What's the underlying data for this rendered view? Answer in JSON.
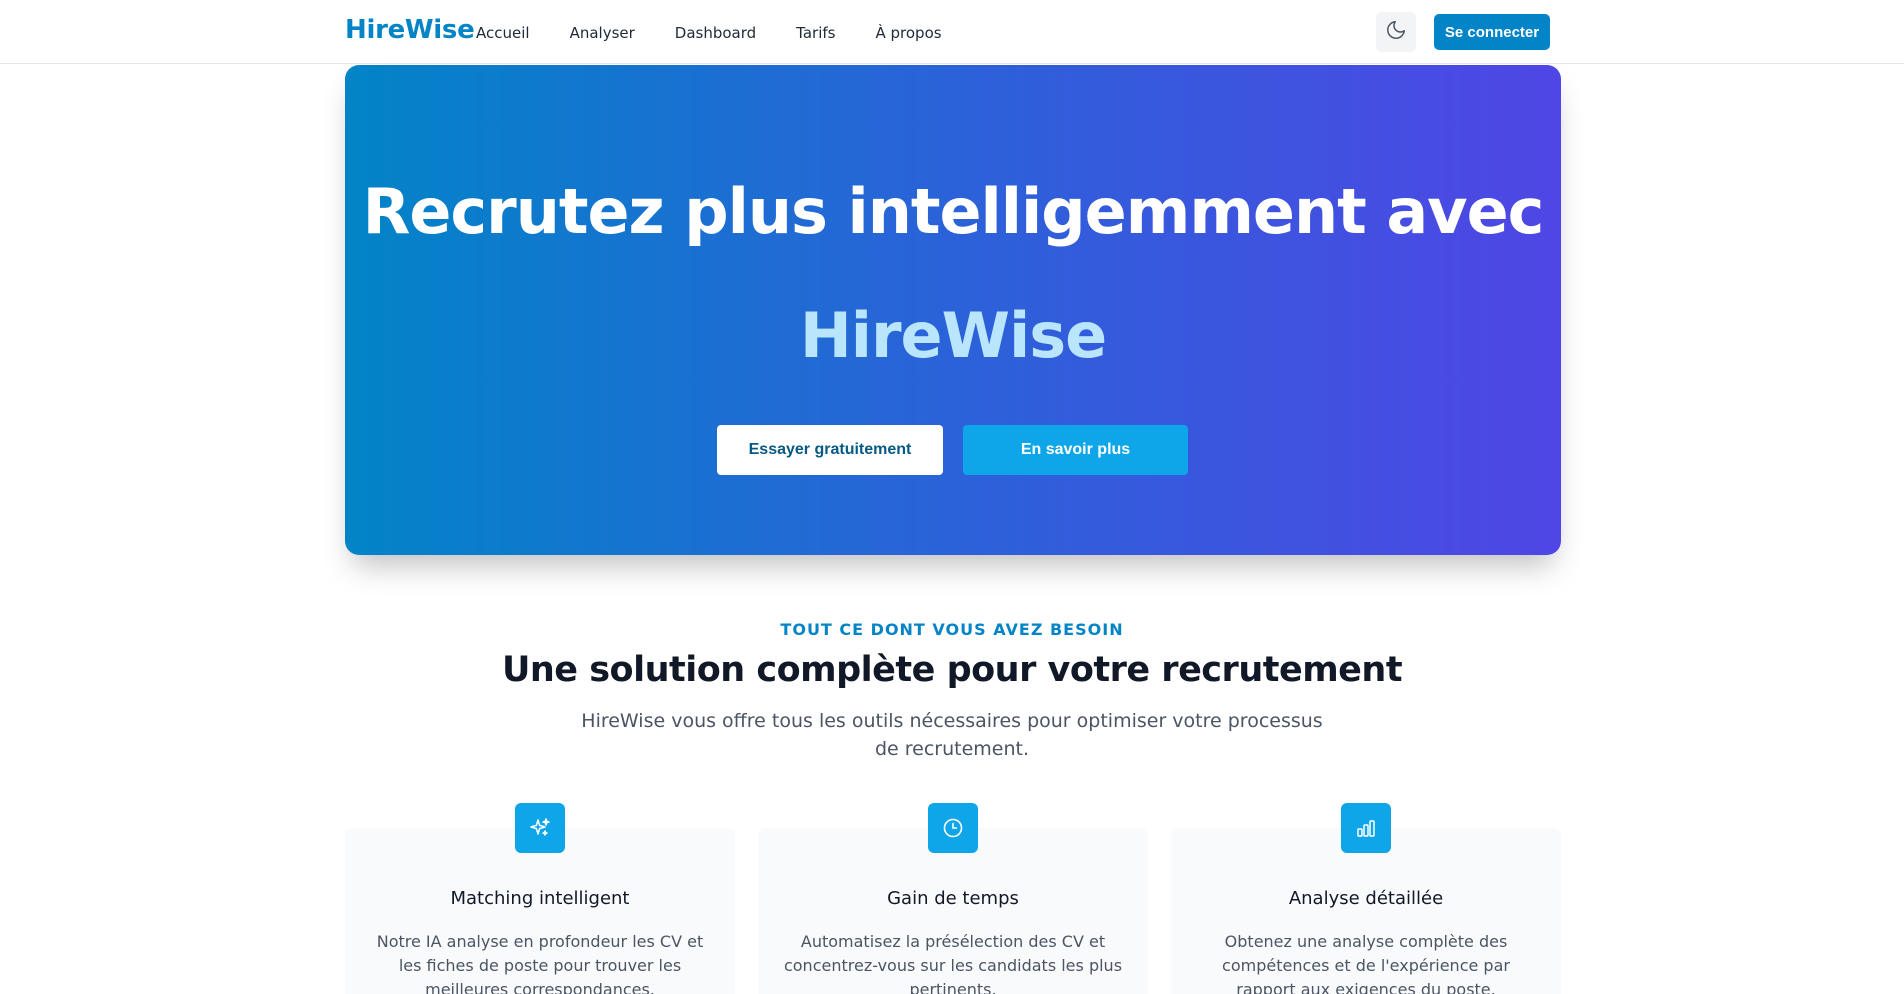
{
  "nav": {
    "brand": "HireWise",
    "links": [
      "Accueil",
      "Analyser",
      "Dashboard",
      "Tarifs",
      "À propos"
    ],
    "theme_icon": "moon-icon",
    "login_label": "Se connecter"
  },
  "hero": {
    "title": "Recrutez plus intelligemment avec",
    "brand": "HireWise",
    "primary_cta": "Essayer gratuitement",
    "secondary_cta": "En savoir plus"
  },
  "features": {
    "eyebrow": "TOUT CE DONT VOUS AVEZ BESOIN",
    "title": "Une solution complète pour votre recrutement",
    "subtitle": "HireWise vous offre tous les outils nécessaires pour optimiser votre processus de recrutement.",
    "cards": [
      {
        "icon": "sparkles-icon",
        "title": "Matching intelligent",
        "description": "Notre IA analyse en profondeur les CV et les fiches de poste pour trouver les meilleures correspondances."
      },
      {
        "icon": "clock-icon",
        "title": "Gain de temps",
        "description": "Automatisez la présélection des CV et concentrez-vous sur les candidats les plus pertinents."
      },
      {
        "icon": "bar-chart-icon",
        "title": "Analyse détaillée",
        "description": "Obtenez une analyse complète des compétences et de l'expérience par rapport aux exigences du poste."
      }
    ]
  },
  "colors": {
    "primary": "#0284c7",
    "accent": "#0ea5e9",
    "gradient_start": "#0284c7",
    "gradient_end": "#4f46e5",
    "hero_brand": "#bae6fd"
  }
}
